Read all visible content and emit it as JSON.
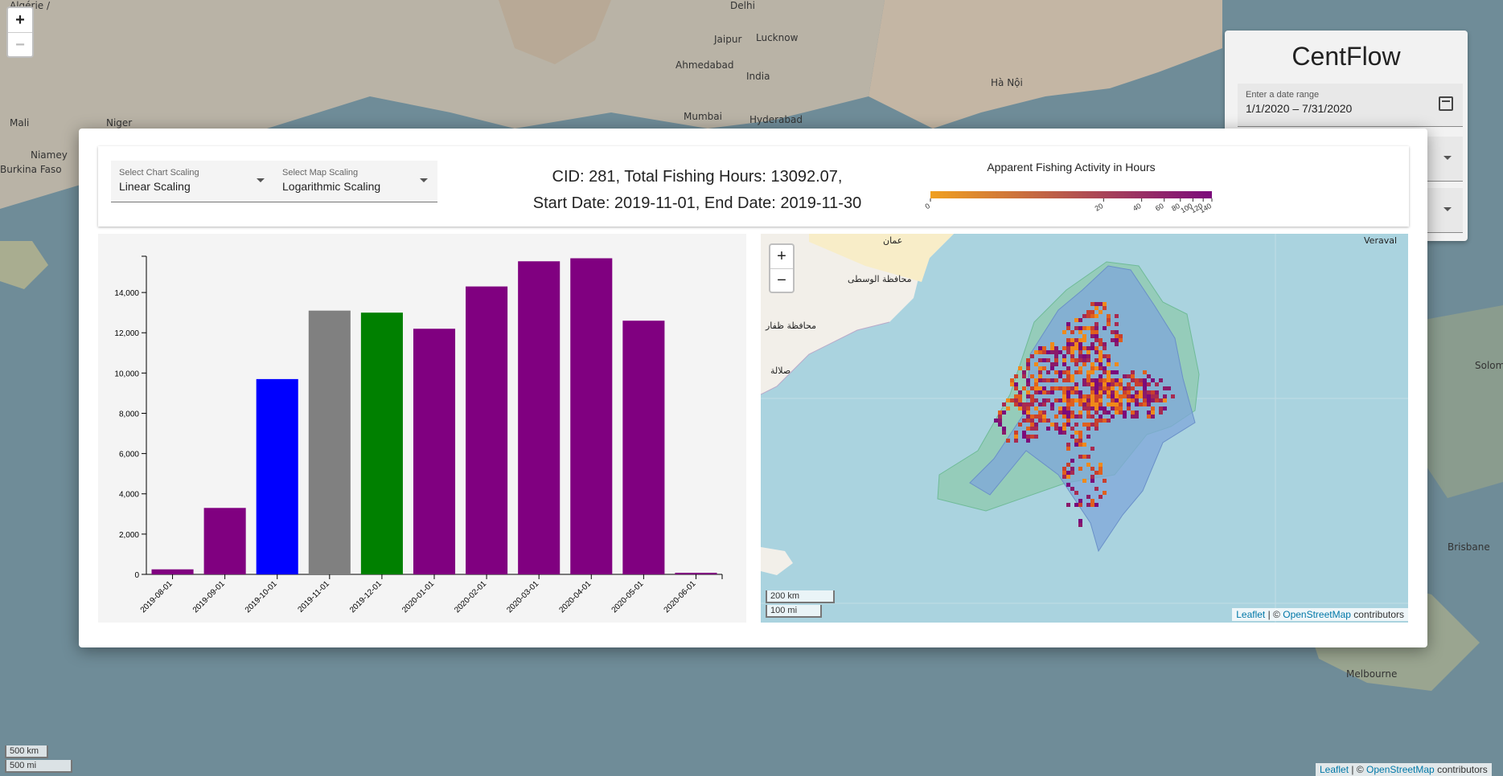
{
  "app": {
    "title": "CentFlow",
    "date_range_label": "Enter a date range",
    "date_range_value": "1/1/2020 – 7/31/2020"
  },
  "background_map": {
    "zoom_in": "+",
    "zoom_out": "−",
    "scale_km": "500 km",
    "scale_mi": "500 mi",
    "attribution_leaflet": "Leaflet",
    "attribution_sep": "| ©",
    "attribution_osm": "OpenStreetMap",
    "attribution_tail": "contributors",
    "labels": [
      {
        "text": "Algérie /",
        "left": 12,
        "top": 0
      },
      {
        "text": "Mali",
        "left": 12,
        "top": 146
      },
      {
        "text": "Niger",
        "left": 132,
        "top": 146
      },
      {
        "text": "Niamey",
        "left": 38,
        "top": 186
      },
      {
        "text": "Burkina Faso",
        "left": 0,
        "top": 204
      },
      {
        "text": "Delhi",
        "left": 908,
        "top": 0
      },
      {
        "text": "Jaipur",
        "left": 888,
        "top": 42
      },
      {
        "text": "Lucknow",
        "left": 940,
        "top": 40
      },
      {
        "text": "India",
        "left": 928,
        "top": 88
      },
      {
        "text": "Ahmedabad",
        "left": 840,
        "top": 74
      },
      {
        "text": "Mumbai",
        "left": 850,
        "top": 138
      },
      {
        "text": "Hyderabad",
        "left": 932,
        "top": 142
      },
      {
        "text": "Hà Nội",
        "left": 1232,
        "top": 96
      },
      {
        "text": "Melbourne",
        "left": 1674,
        "top": 832
      },
      {
        "text": "Brisbane",
        "left": 1800,
        "top": 674
      },
      {
        "text": "Solomon Islands",
        "left": 1834,
        "top": 448
      }
    ]
  },
  "modal": {
    "chart_scaling": {
      "label": "Select Chart Scaling",
      "value": "Linear Scaling"
    },
    "map_scaling": {
      "label": "Select Map Scaling",
      "value": "Logarithmic Scaling"
    },
    "info_line1": "CID: 281, Total Fishing Hours: 13092.07,",
    "info_line2": "Start Date: 2019-11-01, End Date: 2019-11-30",
    "legend": {
      "title": "Apparent Fishing Activity in Hours",
      "ticks": [
        "0",
        "20",
        "40",
        "60",
        "80",
        "100",
        "120",
        "140"
      ],
      "color_start": "#f0a020",
      "color_end": "#7b0a7b"
    },
    "map": {
      "zoom_in": "+",
      "zoom_out": "−",
      "scale_km": "200 km",
      "scale_mi": "100 mi",
      "attribution_leaflet": "Leaflet",
      "attribution_sep": "| ©",
      "attribution_osm": "OpenStreetMap",
      "attribution_tail": "contributors",
      "place_labels": [
        {
          "text": "عمان",
          "left": 152,
          "top": 2
        },
        {
          "text": "محافظة الوسطى",
          "left": 108,
          "top": 50
        },
        {
          "text": "محافظة ظفار",
          "left": 6,
          "top": 108
        },
        {
          "text": "صلالة",
          "left": 12,
          "top": 164
        },
        {
          "text": "Veraval",
          "left": 750,
          "top": 2
        }
      ]
    }
  },
  "chart_data": {
    "type": "bar",
    "categories": [
      "2019-08-01",
      "2019-09-01",
      "2019-10-01",
      "2019-11-01",
      "2019-12-01",
      "2020-01-01",
      "2020-02-01",
      "2020-03-01",
      "2020-04-01",
      "2020-05-01",
      "2020-06-01"
    ],
    "values": [
      250,
      3300,
      9700,
      13100,
      13000,
      12200,
      14300,
      15550,
      15700,
      12600,
      0
    ],
    "colors": [
      "#800080",
      "#800080",
      "#0000ff",
      "#808080",
      "#008000",
      "#800080",
      "#800080",
      "#800080",
      "#800080",
      "#800080",
      "#800080"
    ],
    "yticks": [
      0,
      2000,
      4000,
      6000,
      8000,
      10000,
      12000,
      14000
    ],
    "ytick_labels": [
      "0",
      "2,000",
      "4,000",
      "6,000",
      "8,000",
      "10,000",
      "12,000",
      "14,000"
    ],
    "ylim": [
      0,
      15800
    ],
    "title": "",
    "xlabel": "",
    "ylabel": ""
  }
}
